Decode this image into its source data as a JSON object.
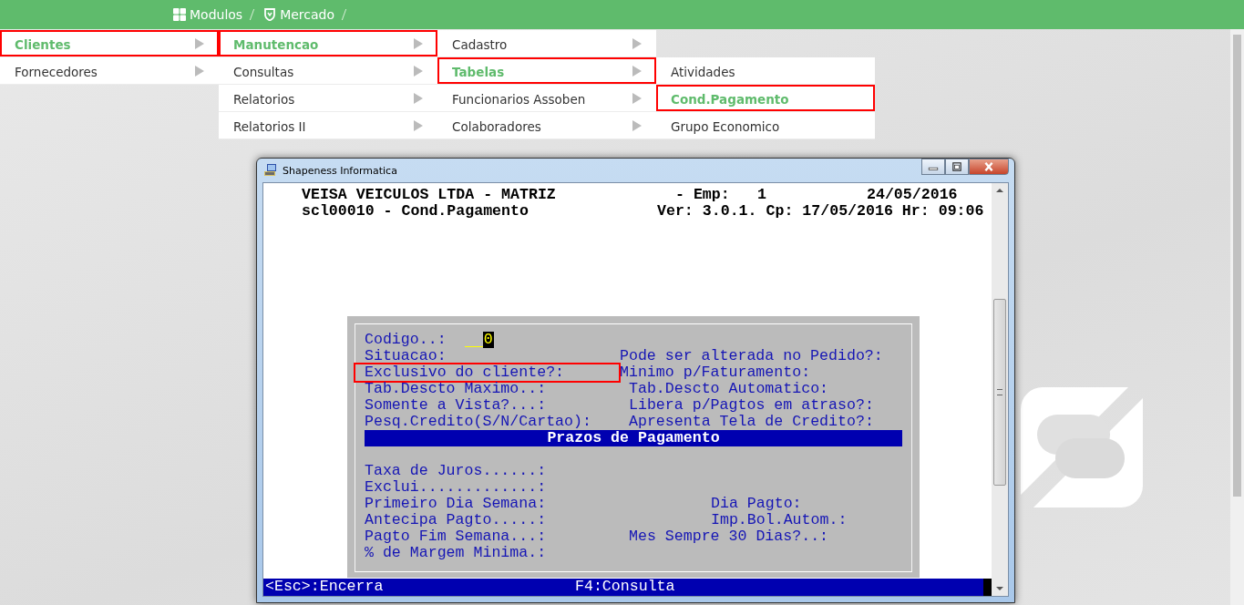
{
  "breadcrumbs": [
    {
      "label": "Modulos",
      "kind": "grid"
    },
    {
      "label": "Mercado",
      "kind": "shield"
    }
  ],
  "menus": [
    {
      "items": [
        {
          "label": "Clientes",
          "selected": true,
          "highlighted": true
        },
        {
          "label": "Fornecedores",
          "selected": false,
          "highlighted": false
        }
      ]
    },
    {
      "items": [
        {
          "label": "Manutencao",
          "selected": true,
          "highlighted": true
        },
        {
          "label": "Consultas",
          "selected": false,
          "highlighted": false
        },
        {
          "label": "Relatorios",
          "selected": false,
          "highlighted": false
        },
        {
          "label": "Relatorios II",
          "selected": false,
          "highlighted": false
        }
      ]
    },
    {
      "items": [
        {
          "label": "Cadastro",
          "selected": false,
          "highlighted": false
        },
        {
          "label": "Tabelas",
          "selected": true,
          "highlighted": true
        },
        {
          "label": "Funcionarios Assoben",
          "selected": false,
          "highlighted": false
        },
        {
          "label": "Colaboradores",
          "selected": false,
          "highlighted": false
        }
      ]
    },
    {
      "items": [
        {
          "label": "Atividades",
          "selected": false,
          "highlighted": false
        },
        {
          "label": "Cond.Pagamento",
          "selected": true,
          "highlighted": true
        },
        {
          "label": "Grupo Economico",
          "selected": false,
          "highlighted": false
        }
      ]
    }
  ],
  "window": {
    "title": "Shapeness Informatica"
  },
  "terminal": {
    "header": {
      "company": "VEISA VEICULOS LTDA - MATRIZ",
      "emp_label": "- Emp:",
      "emp": "1",
      "date": "24/05/2016",
      "program": "scl00010 - Cond.Pagamento",
      "version": "Ver: 3.0.1. Cp: 17/05/2016 Hr: 09:06"
    },
    "rows": [
      {
        "kind": "field",
        "left": {
          "label": "Codigo..:",
          "highlighted": false
        },
        "value": "0"
      },
      {
        "kind": "field",
        "left": {
          "label": "Situacao:",
          "highlighted": false
        },
        "right": {
          "label": "Pode ser alterada no Pedido?:",
          "kind": "near"
        }
      },
      {
        "kind": "field",
        "left": {
          "label": "Exclusivo do cliente?:",
          "highlighted": true
        },
        "right": {
          "label": "Minimo p/Faturamento:",
          "kind": "near"
        }
      },
      {
        "kind": "field",
        "left": {
          "label": "Tab.Descto Maximo..:",
          "highlighted": false
        },
        "right": {
          "label": "Tab.Descto Automatico:",
          "kind": "mid"
        }
      },
      {
        "kind": "field",
        "left": {
          "label": "Somente a Vista?...:",
          "highlighted": false
        },
        "right": {
          "label": "Libera p/Pagtos em atraso?:",
          "kind": "mid"
        }
      },
      {
        "kind": "field",
        "left": {
          "label": "Pesq.Credito(S/N/Cartao):",
          "highlighted": false
        },
        "right": {
          "label": "Apresenta Tela de Credito?:",
          "kind": "mid"
        }
      },
      {
        "kind": "section",
        "label": "Prazos de Pagamento"
      },
      {
        "kind": "spacer"
      },
      {
        "kind": "field",
        "left": {
          "label": "Taxa de Juros......:",
          "highlighted": false
        }
      },
      {
        "kind": "field",
        "left": {
          "label": "Exclui.............:",
          "highlighted": false
        }
      },
      {
        "kind": "field",
        "left": {
          "label": "Primeiro Dia Semana:",
          "highlighted": false
        },
        "right": {
          "label": "Dia Pagto:",
          "kind": "far"
        }
      },
      {
        "kind": "field",
        "left": {
          "label": "Antecipa Pagto.....:",
          "highlighted": false
        },
        "right": {
          "label": "Imp.Bol.Autom.:",
          "kind": "far"
        }
      },
      {
        "kind": "field",
        "left": {
          "label": "Pagto Fim Semana...:",
          "highlighted": false
        },
        "right": {
          "label": "Mes Sempre 30 Dias?..:",
          "kind": "mid"
        }
      },
      {
        "kind": "field",
        "left": {
          "label": "% de Margem Minima.:",
          "highlighted": false
        }
      }
    ],
    "status": [
      {
        "label": "<Esc>:Encerra"
      },
      {
        "label": "F4:Consulta"
      }
    ]
  }
}
